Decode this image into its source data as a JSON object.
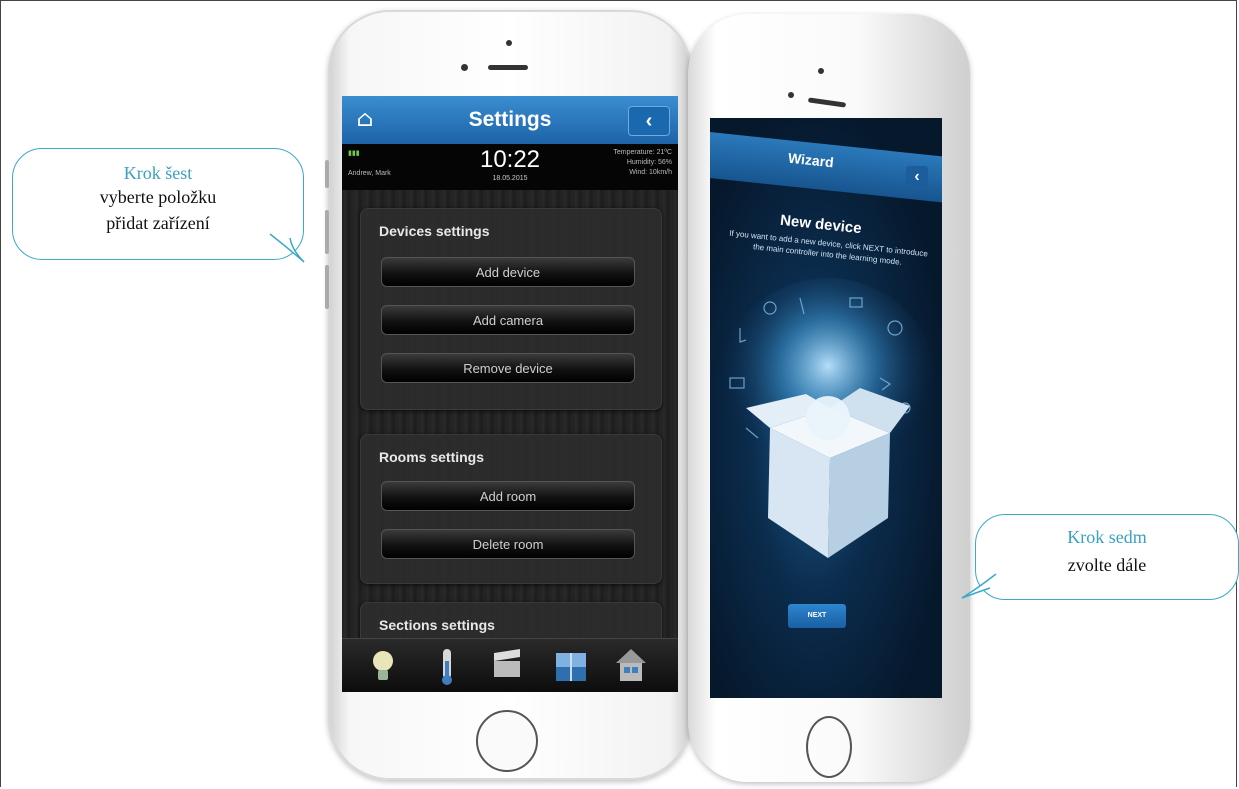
{
  "bubbles": {
    "left": {
      "title": "Krok šest",
      "line1": "vyberte položku",
      "line2": "přidat zařízení"
    },
    "right": {
      "title": "Krok sedm",
      "line1": "zvolte dále"
    }
  },
  "phone_settings": {
    "header": {
      "title": "Settings",
      "back_icon": "chevron-left-icon"
    },
    "status": {
      "user": "Andrew, Mark",
      "time": "10:22",
      "date": "18.05.2015",
      "temperature": "Temperature: 21ºC",
      "humidity": "Humidity: 56%",
      "wind": "Wind: 10km/h"
    },
    "sections": {
      "devices": {
        "title": "Devices settings",
        "buttons": [
          "Add device",
          "Add camera",
          "Remove device"
        ]
      },
      "rooms": {
        "title": "Rooms settings",
        "buttons": [
          "Add room",
          "Delete room"
        ]
      },
      "sections_title": "Sections settings"
    },
    "tabs": [
      "bulb-icon",
      "thermometer-icon",
      "clapperboard-icon",
      "window-icon",
      "house-icon"
    ]
  },
  "phone_wizard": {
    "header": {
      "title": "Wizard",
      "back_icon": "chevron-left-icon"
    },
    "heading": "New device",
    "text": "If you want to add a new device, click NEXT to introduce the main controller into the learning mode.",
    "next_label": "NEXT"
  },
  "colors": {
    "accent": "#1f6fb5",
    "bubble_border": "#3ba9c8",
    "bubble_title": "#3aa0c0"
  }
}
